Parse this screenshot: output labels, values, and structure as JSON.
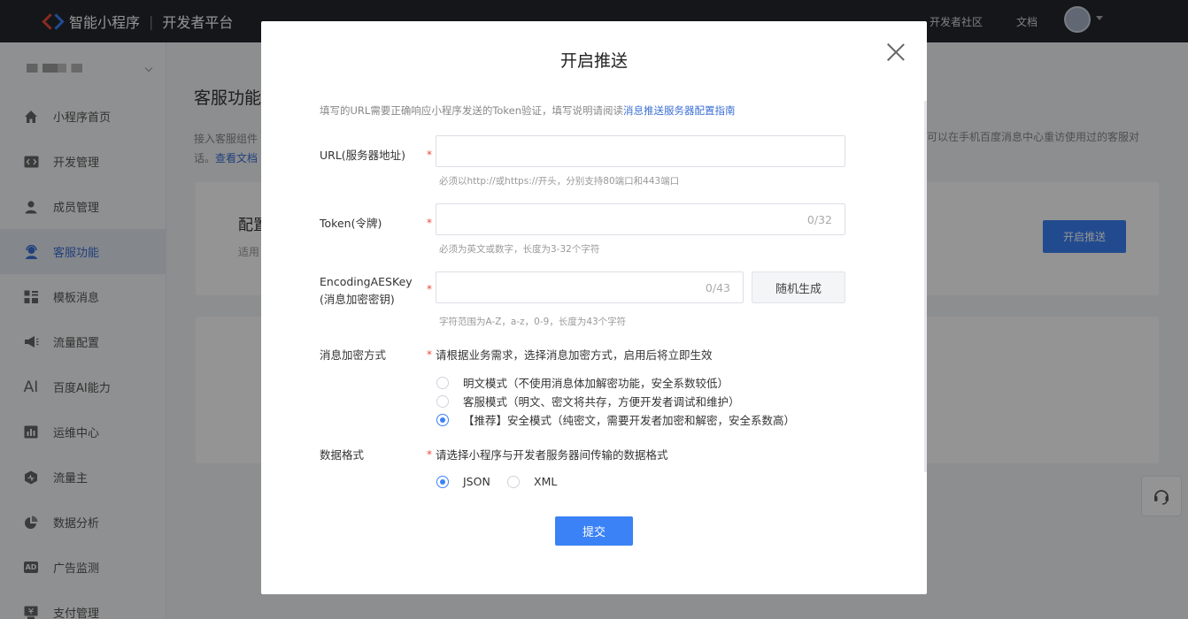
{
  "topbar": {
    "brand": "智能小程序",
    "separator": "|",
    "platform": "开发者平台",
    "links": [
      "开发者社区",
      "文档"
    ]
  },
  "sidebar": {
    "items": [
      {
        "label": "小程序首页",
        "icon": "home-icon"
      },
      {
        "label": "开发管理",
        "icon": "code-icon"
      },
      {
        "label": "成员管理",
        "icon": "user-icon"
      },
      {
        "label": "客服功能",
        "icon": "headset-icon",
        "active": true
      },
      {
        "label": "模板消息",
        "icon": "template-icon"
      },
      {
        "label": "流量配置",
        "icon": "megaphone-icon"
      },
      {
        "label": "百度AI能力",
        "icon": "ai-icon",
        "glyph": "AI"
      },
      {
        "label": "运维中心",
        "icon": "chart-icon"
      },
      {
        "label": "流量主",
        "icon": "hexagon-icon"
      },
      {
        "label": "数据分析",
        "icon": "pie-icon"
      },
      {
        "label": "广告监测",
        "icon": "ad-icon",
        "glyph": "AD"
      },
      {
        "label": "支付管理",
        "icon": "payment-icon"
      }
    ]
  },
  "main": {
    "title": "客服功能",
    "desc_left": "接入客服组件",
    "desc_right": "可以在手机百度消息中心重访使用过的客服对",
    "desc_line2_prefix": "话。",
    "desc_link": "查看文档",
    "card_title": "配置",
    "card_sub": "适用",
    "push_button": "开启推送"
  },
  "modal": {
    "title": "开启推送",
    "intro_text": "填写的URL需要正确响应小程序发送的Token验证，填写说明请阅读",
    "intro_link": "消息推送服务器配置指南",
    "url": {
      "label": "URL(服务器地址)",
      "value": "",
      "hint": "必须以http://或https://开头，分别支持80端口和443端口"
    },
    "token": {
      "label": "Token(令牌)",
      "value": "",
      "counter": "0/32",
      "hint": "必须为英文或数字，长度为3-32个字符"
    },
    "aeskey": {
      "label_line1": "EncodingAESKey",
      "label_line2": "(消息加密密钥)",
      "value": "",
      "counter": "0/43",
      "generate_button": "随机生成",
      "hint": "字符范围为A-Z，a-z，0-9，长度为43个字符"
    },
    "encryption": {
      "label": "消息加密方式",
      "note": "请根据业务需求，选择消息加密方式，启用后将立即生效",
      "options": [
        {
          "label": "明文模式（不使用消息体加解密功能，安全系数较低）",
          "checked": false
        },
        {
          "label": "客服模式（明文、密文将共存，方便开发者调试和维护）",
          "checked": false
        },
        {
          "label": "【推荐】安全模式（纯密文，需要开发者加密和解密，安全系数高）",
          "checked": true
        }
      ]
    },
    "format": {
      "label": "数据格式",
      "note": "请选择小程序与开发者服务器间传输的数据格式",
      "options": [
        {
          "label": "JSON",
          "checked": true
        },
        {
          "label": "XML",
          "checked": false
        }
      ]
    },
    "submit": "提交",
    "required_mark": "*"
  },
  "colors": {
    "accent": "#3b82f6",
    "required": "#e94b3c",
    "topbar": "#23262e"
  }
}
